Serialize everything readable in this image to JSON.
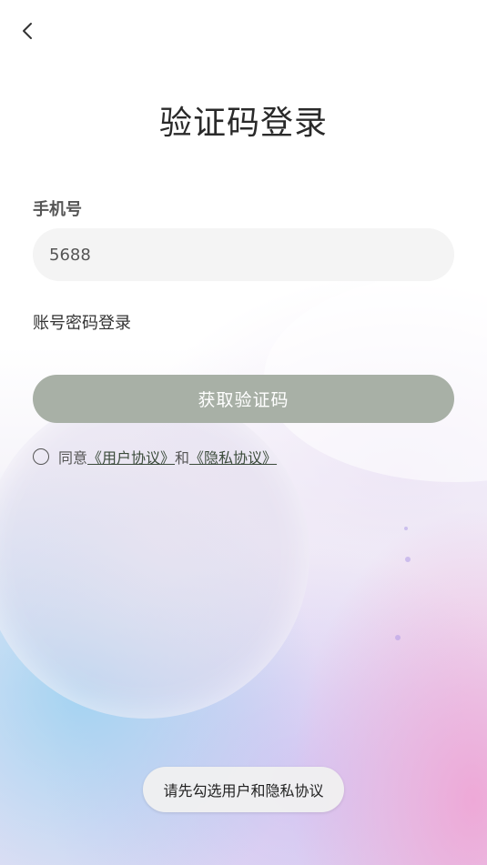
{
  "header": {
    "back_icon": "chevron-left-icon",
    "title": "验证码登录"
  },
  "form": {
    "phone_label": "手机号",
    "phone_value": "5688",
    "password_login_link": "账号密码登录",
    "get_code_button": "获取验证码"
  },
  "agreement": {
    "prefix": "同意",
    "user_agreement": "《用户协议》",
    "conjunction": "和",
    "privacy_policy": "《隐私协议》",
    "checked": false
  },
  "toast": {
    "message": "请先勾选用户和隐私协议"
  },
  "colors": {
    "button_bg": "#a8b0a6",
    "input_bg": "#f4f4f4",
    "title": "#2a2a2a"
  }
}
